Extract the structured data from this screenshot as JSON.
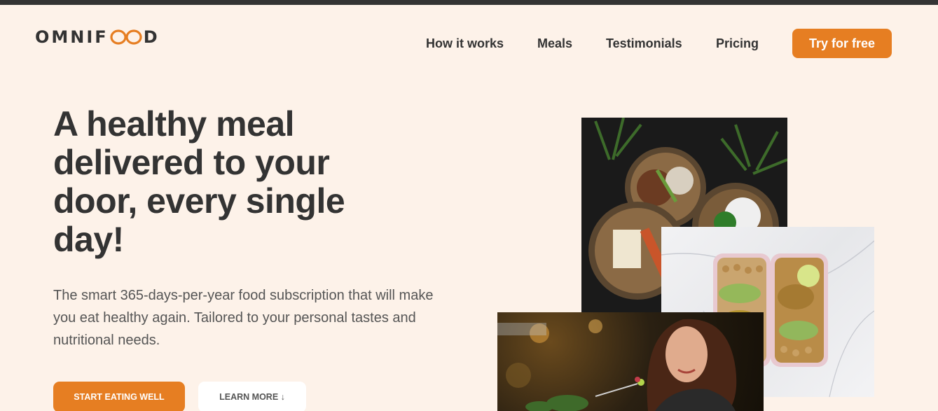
{
  "brand": {
    "name_prefix": "OMNIF",
    "name_suffix": "D",
    "accent_color": "#e67e22"
  },
  "nav": {
    "items": [
      {
        "label": "How it works"
      },
      {
        "label": "Meals"
      },
      {
        "label": "Testimonials"
      },
      {
        "label": "Pricing"
      }
    ],
    "cta_label": "Try for free"
  },
  "hero": {
    "title": "A healthy meal delivered to your door, every single day!",
    "description": "The smart 365-days-per-year food subscription that will make you eat healthy again. Tailored to your personal tastes and nutritional needs.",
    "primary_button": "Start eating well",
    "secondary_button": "Learn more ↓"
  },
  "images": [
    {
      "name": "meal-bowls-photo"
    },
    {
      "name": "meal-prep-boxes-photo"
    },
    {
      "name": "woman-eating-photo"
    }
  ]
}
